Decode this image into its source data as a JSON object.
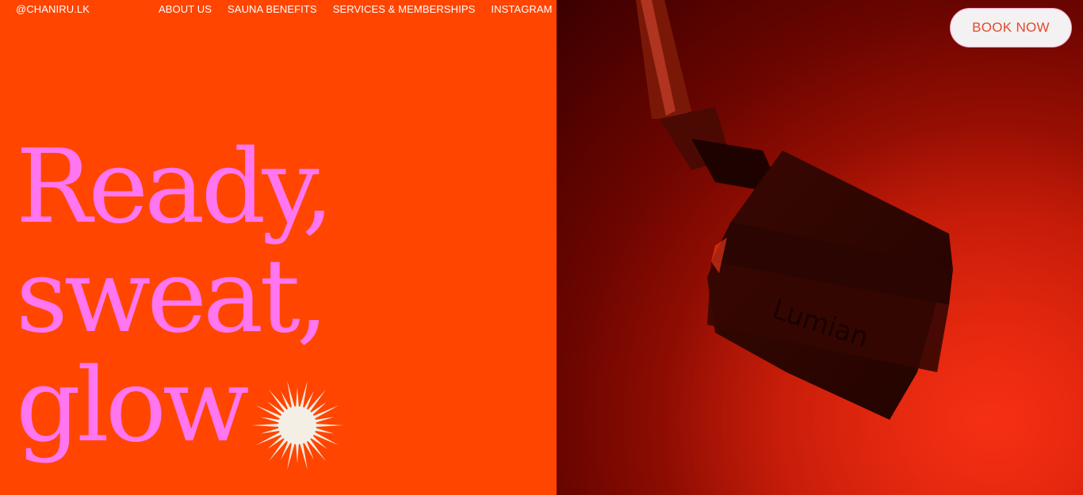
{
  "nav": {
    "handle": "@CHANIRU.LK",
    "links": [
      "ABOUT US",
      "SAUNA BENEFITS",
      "SERVICES & MEMBERSHIPS",
      "INSTAGRAM"
    ],
    "book_label": "BOOK NOW"
  },
  "hero": {
    "line1": "Ready,",
    "line2": "sweat,",
    "line3": "glow"
  },
  "icons": {
    "sun": "sunburst-icon"
  },
  "colors": {
    "left_panel": "#ff4500",
    "hero_text": "#ff76f0",
    "button_text": "#e24a2e",
    "sunburst": "#f4efe4"
  },
  "image": {
    "subject": "red-light-sauna-heater-photo"
  }
}
